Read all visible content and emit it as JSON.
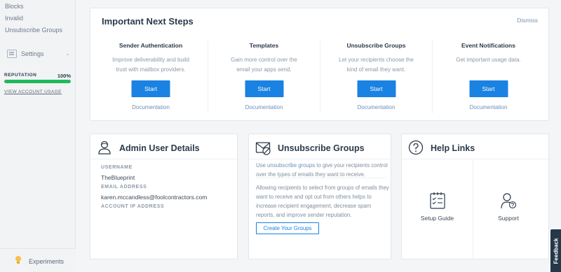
{
  "sidebar": {
    "links": [
      "Blocks",
      "Invalid",
      "Unsubscribe Groups"
    ],
    "settings_label": "Settings",
    "reputation_label": "REPUTATION",
    "reputation_value": "100%",
    "reputation_fraction": 1.0,
    "view_usage": "VIEW ACCOUNT USAGE",
    "experiments": "Experiments"
  },
  "next_steps": {
    "title": "Important Next Steps",
    "dismiss": "Dismiss",
    "items": [
      {
        "title": "Sender Authentication",
        "desc": "Improve deliverability and build trust with mailbox providers.",
        "button": "Start",
        "link": "Documentation"
      },
      {
        "title": "Templates",
        "desc": "Gain more control over the email your apps send.",
        "button": "Start",
        "link": "Documentation"
      },
      {
        "title": "Unsubscribe Groups",
        "desc": "Let your recipients choose the kind of email they want.",
        "button": "Start",
        "link": "Documentation"
      },
      {
        "title": "Event Notifications",
        "desc": "Get important usage data.",
        "button": "Start",
        "link": "Documentation"
      }
    ]
  },
  "admin": {
    "title": "Admin User Details",
    "username_label": "USERNAME",
    "username": "TheBlueprint",
    "email_label": "EMAIL ADDRESS",
    "email": "karen.mccandless@foolcontractors.com",
    "ip_label": "ACCOUNT IP ADDRESS"
  },
  "unsubscribe": {
    "title": "Unsubscribe Groups",
    "p1_prefix": "Use ",
    "p1_link": "unsubscribe groups",
    "p1_suffix": " to give your recipients control over the types of emails they want to receive.",
    "p2": "Allowing recipients to select from groups of emails they want to receive and opt out from others helps to increase recipient engagement, decrease spam reports, and improve sender reputation.",
    "button": "Create Your Groups"
  },
  "help": {
    "title": "Help Links",
    "items": [
      "Setup Guide",
      "Support"
    ]
  },
  "feedback": "Feedback",
  "colors": {
    "accent": "#1a82e2",
    "reputation": "#1fba5b",
    "feedback_bg": "#253748"
  }
}
